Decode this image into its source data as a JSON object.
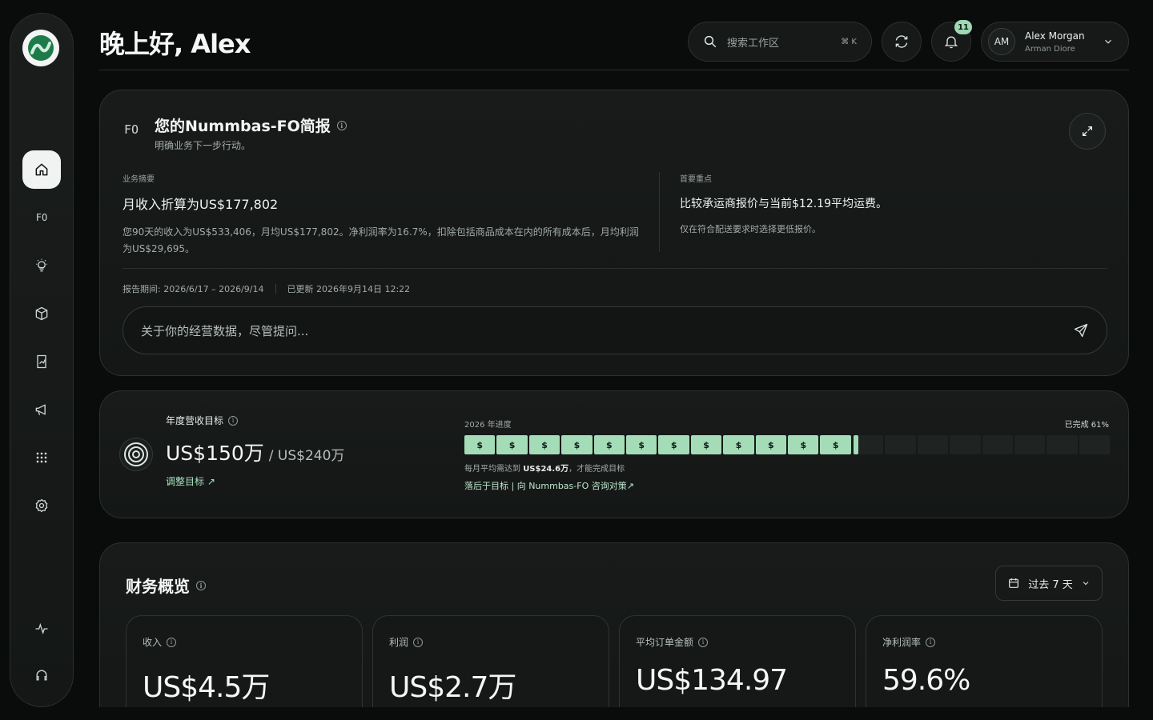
{
  "header": {
    "greeting": "晚上好, Alex",
    "search_placeholder": "搜索工作区",
    "search_shortcut": "⌘ K",
    "notification_count": "11",
    "user_initials": "AM",
    "user_name": "Alex Morgan",
    "user_company": "Arman Diore"
  },
  "sidebar": {
    "items": [
      {
        "name": "home",
        "active": true
      },
      {
        "name": "fo",
        "label": "FO"
      },
      {
        "name": "insights"
      },
      {
        "name": "products"
      },
      {
        "name": "reports"
      },
      {
        "name": "marketing"
      },
      {
        "name": "apps"
      },
      {
        "name": "settings"
      },
      {
        "name": "activity"
      },
      {
        "name": "support"
      }
    ]
  },
  "brief": {
    "icon_label": "FO",
    "title": "您的Nummbas-FO简报",
    "subtitle": "明确业务下一步行动。",
    "summary_label": "业务摘要",
    "summary_head": "月收入折算为US$177,802",
    "summary_body": "您90天的收入为US$533,406，月均US$177,802。净利润率为16.7%，扣除包括商品成本在内的所有成本后，月均利润为US$29,695。",
    "focus_label": "首要重点",
    "focus_head": "比较承运商报价与当前$12.19平均运费。",
    "focus_body": "仅在符合配送要求时选择更低报价。",
    "period": "报告期间:  2026/6/17 – 2026/9/14",
    "updated": "已更新 2026年9月14日 12:22",
    "ask_placeholder": "关于你的经营数据，尽管提问..."
  },
  "goal": {
    "label": "年度营收目标",
    "current": "US$150万",
    "target": "/ US$240万",
    "adjust_link": "调整目标 ↗",
    "progress_label": "2026 年进度",
    "completed": "已完成 61%",
    "progress": 0.61,
    "segment_symbol": "$",
    "segments_total": 20,
    "segments_filled": 12,
    "note_prefix": "每月平均需达到 ",
    "note_value": "US$24.6万",
    "note_suffix": "，才能完成目标",
    "advice": "落后于目标 | 向 Nummbas-FO 咨询对策↗"
  },
  "finance": {
    "title": "财务概览",
    "range": "过去 7 天",
    "kpis": [
      {
        "label": "收入",
        "value": "US$4.5万"
      },
      {
        "label": "利润",
        "value": "US$2.7万"
      },
      {
        "label": "平均订单金额",
        "value": "US$134.97"
      },
      {
        "label": "净利润率",
        "value": "59.6%"
      }
    ]
  },
  "colors": {
    "accent": "#a4dcb8",
    "background": "#0a0b0b",
    "card": "#161918"
  }
}
